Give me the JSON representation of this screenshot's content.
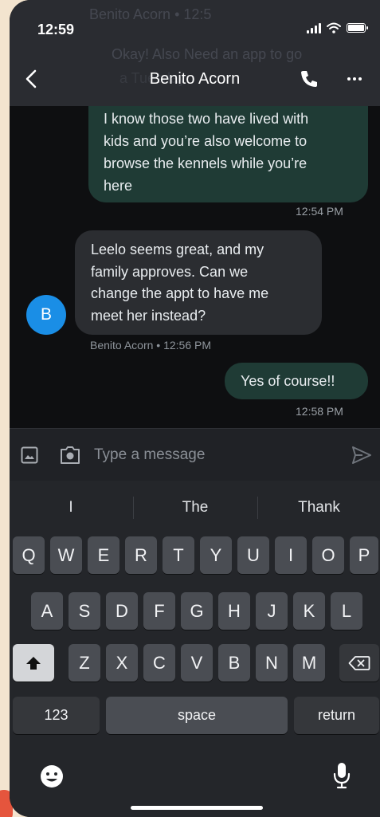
{
  "status": {
    "time": "12:59"
  },
  "header": {
    "contact_name": "Benito Acorn",
    "ghost_line_1": "Benito Acorn • 12:5",
    "ghost_line_2": "Okay! Also Need an app to go",
    "ghost_line_3": "a Tuesday"
  },
  "messages": [
    {
      "direction": "outgoing",
      "text_lines": [
        "I know those two have lived with",
        "kids and you’re also welcome to",
        "browse the kennels while you’re",
        "here"
      ],
      "timestamp": "12:54 PM"
    },
    {
      "direction": "incoming",
      "text_lines": [
        "Leelo seems great, and my",
        "family approves. Can we",
        "change the appt to have me",
        "meet her instead?"
      ],
      "sender_initial": "B",
      "meta": "Benito Acorn • 12:56 PM"
    },
    {
      "direction": "outgoing",
      "text_lines": [
        "Yes of course!!"
      ],
      "timestamp": "12:58 PM"
    }
  ],
  "composer": {
    "placeholder": "Type a message"
  },
  "keyboard": {
    "suggestions": [
      "I",
      "The",
      "Thank"
    ],
    "row1": [
      "Q",
      "W",
      "E",
      "R",
      "T",
      "Y",
      "U",
      "I",
      "O",
      "P"
    ],
    "row2": [
      "A",
      "S",
      "D",
      "F",
      "G",
      "H",
      "J",
      "K",
      "L"
    ],
    "row3": [
      "Z",
      "X",
      "C",
      "V",
      "B",
      "N",
      "M"
    ],
    "numbers_label": "123",
    "space_label": "space",
    "return_label": "return"
  },
  "colors": {
    "outgoing_bubble": "#1f3b35",
    "incoming_bubble": "#2b2d31",
    "avatar": "#1a8ee6",
    "background": "#0e0f11"
  },
  "icons": [
    "back-icon",
    "phone-icon",
    "more-icon",
    "gallery-icon",
    "camera-icon",
    "send-icon",
    "shift-icon",
    "backspace-icon",
    "emoji-icon",
    "microphone-icon"
  ]
}
